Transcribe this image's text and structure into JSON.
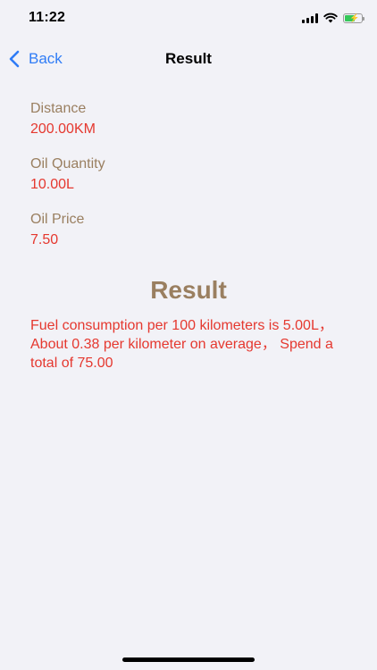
{
  "status_bar": {
    "time": "11:22"
  },
  "nav": {
    "back_label": "Back",
    "title": "Result"
  },
  "fields": {
    "distance": {
      "label": "Distance",
      "value": "200.00KM"
    },
    "oil_quantity": {
      "label": "Oil Quantity",
      "value": "10.00L"
    },
    "oil_price": {
      "label": "Oil Price",
      "value": "7.50"
    }
  },
  "result": {
    "heading": "Result",
    "text": "Fuel consumption per 100 kilometers is 5.00L， About 0.38 per kilometer on average， Spend a total of 75.00"
  },
  "colors": {
    "accent_blue": "#2f7cf6",
    "label_brown": "#9a7f60",
    "value_red": "#e5382f",
    "background": "#f2f2f7"
  }
}
